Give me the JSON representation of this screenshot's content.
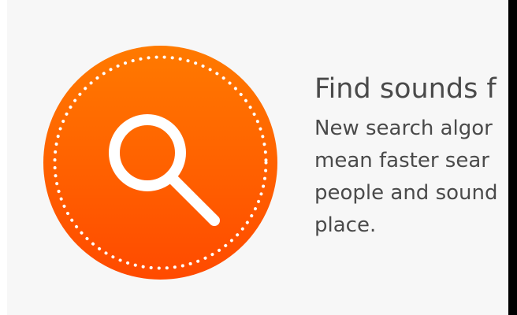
{
  "feature": {
    "icon": "search-icon",
    "badge_color": "#ff6200",
    "headline": "Find sounds f",
    "description_lines": [
      "New search algor",
      "mean faster sear",
      "people and sound",
      "place."
    ]
  }
}
